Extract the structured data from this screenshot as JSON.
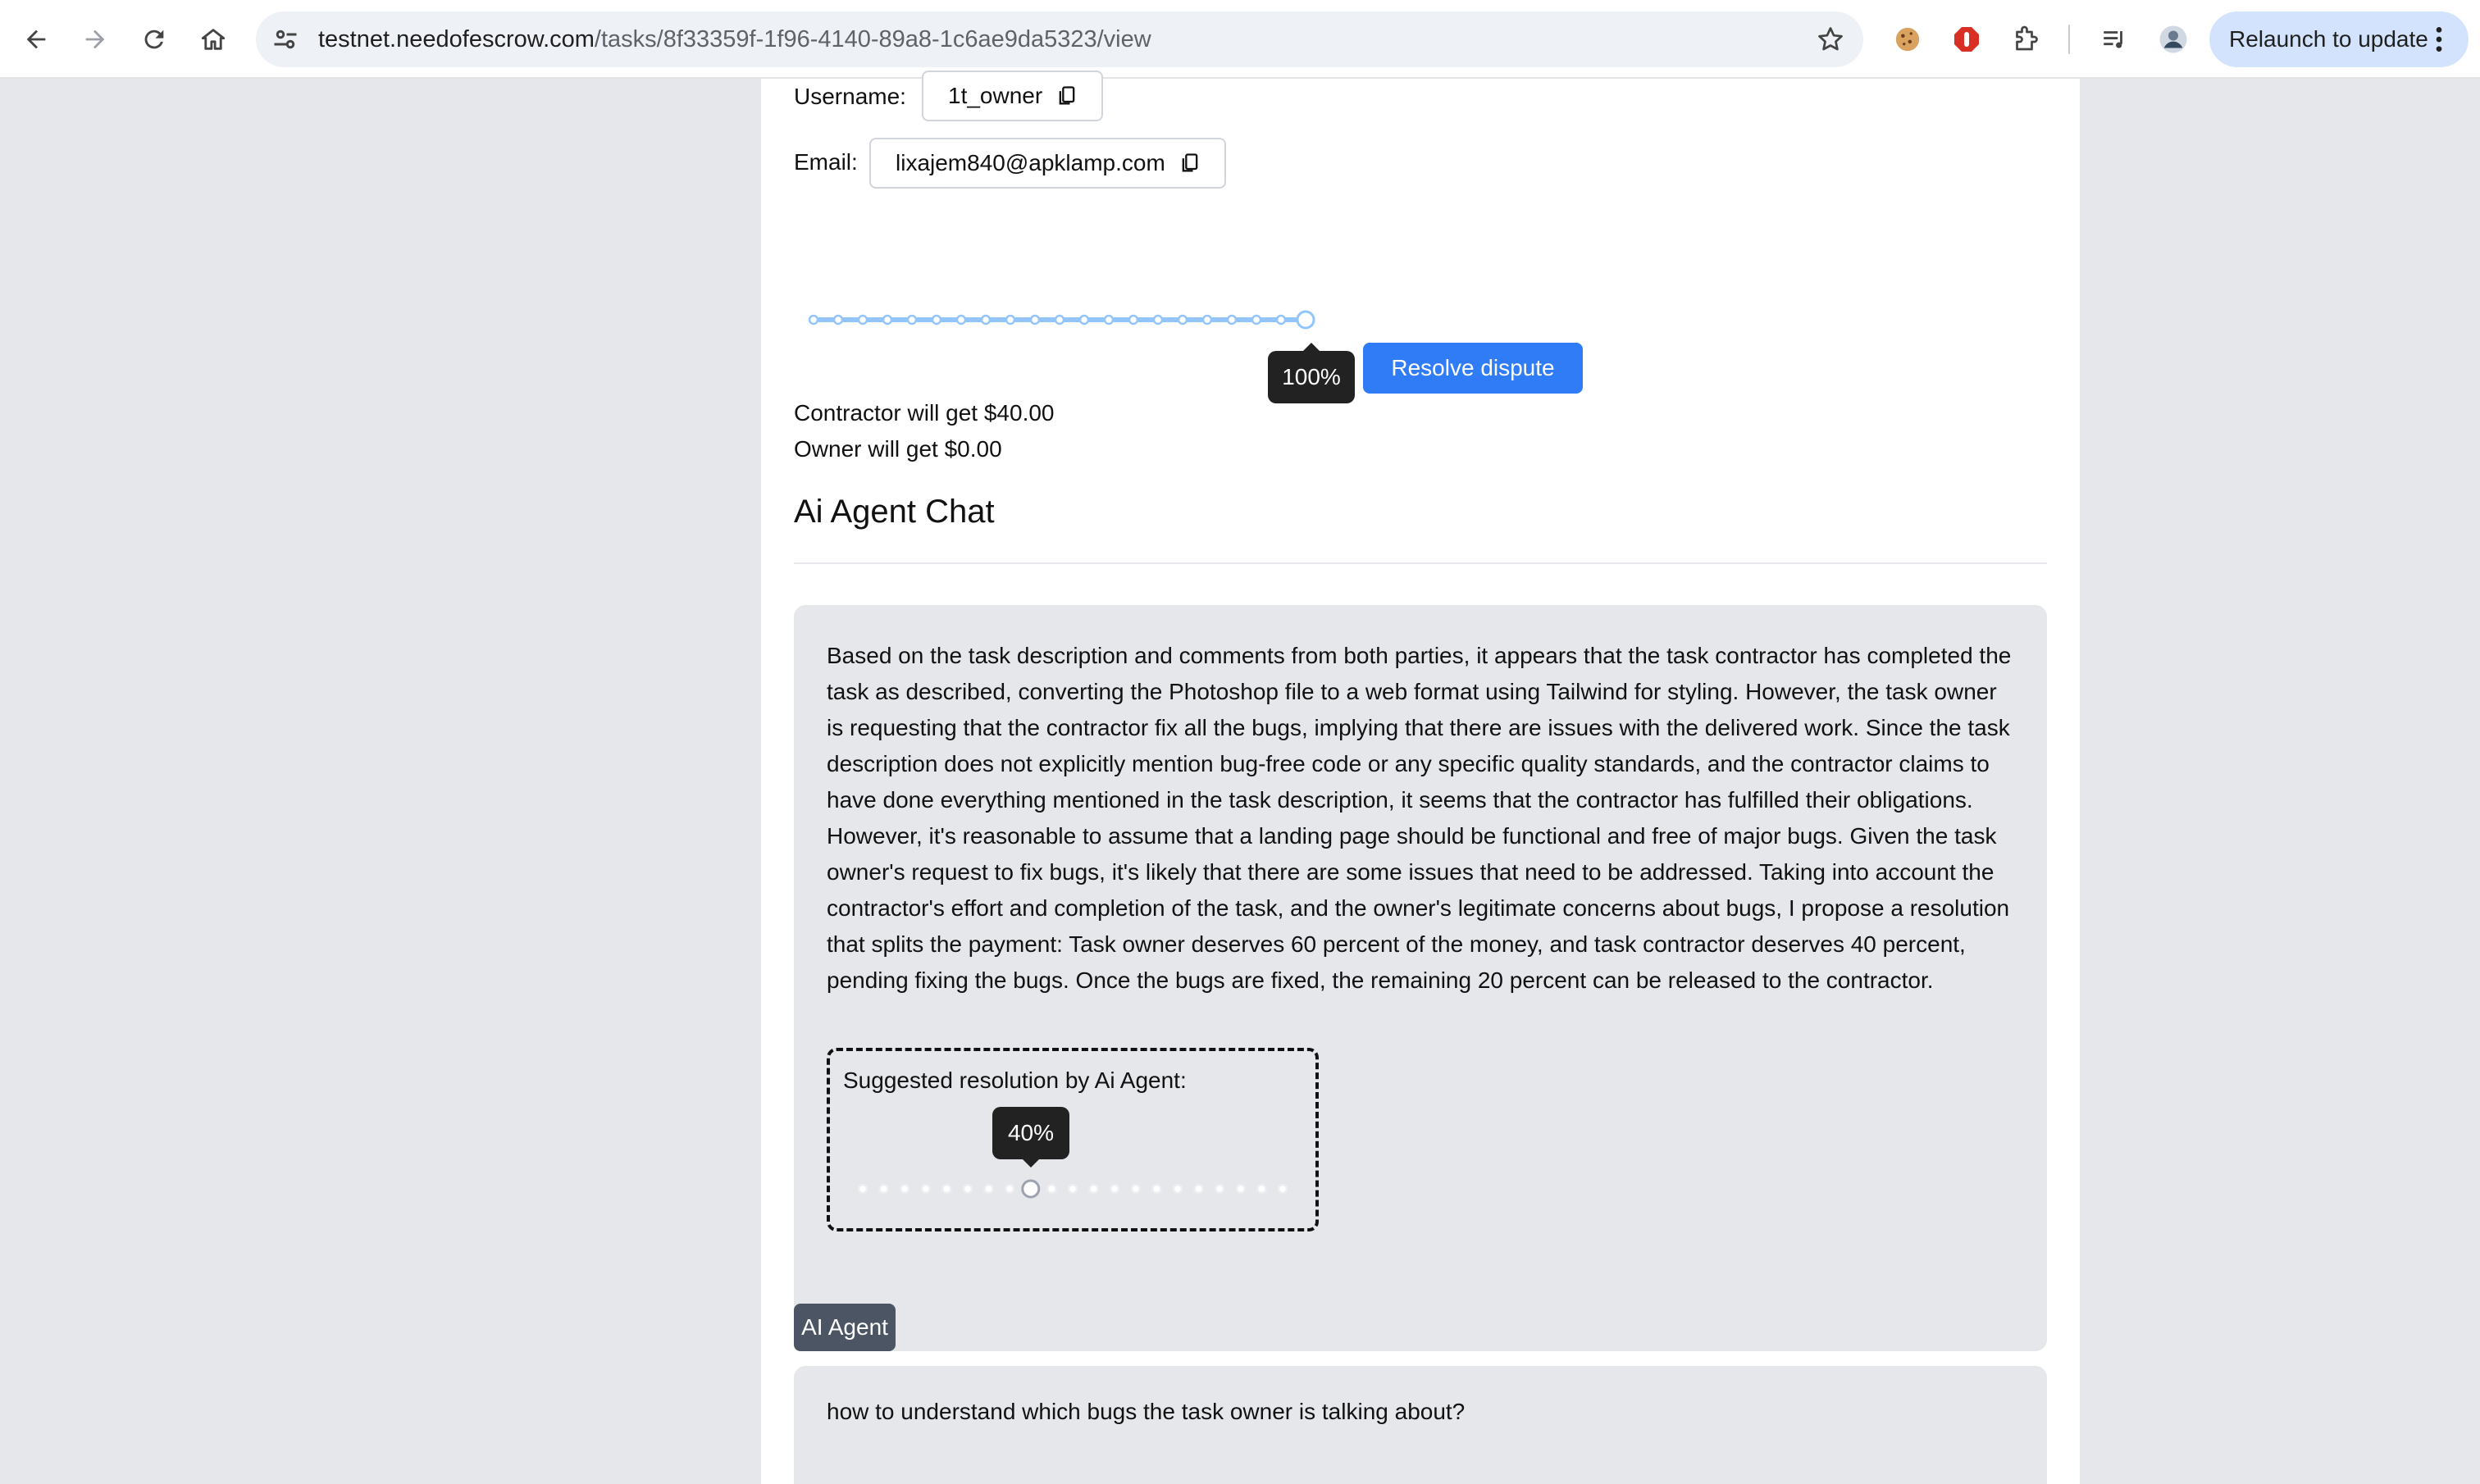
{
  "browser": {
    "url_host": "testnet.needofescrow.com",
    "url_path": "/tasks/8f33359f-1f96-4140-89a8-1c6ae9da5323/view",
    "relaunch_label": "Relaunch to update"
  },
  "user": {
    "username_label": "Username:",
    "username_value": "1t_owner",
    "email_label": "Email:",
    "email_value": "lixajem840@apklamp.com"
  },
  "dispute": {
    "slider_value_label": "100%",
    "slider_percent": 100,
    "slider_steps": 20,
    "resolve_button": "Resolve dispute",
    "contractor_text": "Contractor will get $40.00",
    "owner_text": "Owner will get $0.00"
  },
  "chat": {
    "title": "Ai Agent Chat",
    "agent_message": "Based on the task description and comments from both parties, it appears that the task contractor has completed the task as described, converting the Photoshop file to a web format using Tailwind for styling. However, the task owner is requesting that the contractor fix all the bugs, implying that there are issues with the delivered work. Since the task description does not explicitly mention bug-free code or any specific quality standards, and the contractor claims to have done everything mentioned in the task description, it seems that the contractor has fulfilled their obligations. However, it's reasonable to assume that a landing page should be functional and free of major bugs. Given the task owner's request to fix bugs, it's likely that there are some issues that need to be addressed. Taking into account the contractor's effort and completion of the task, and the owner's legitimate concerns about bugs, I propose a resolution that splits the payment: Task owner deserves 60 percent of the money, and task contractor deserves 40 percent, pending fixing the bugs. Once the bugs are fixed, the remaining 20 percent can be released to the contractor.",
    "suggested_label": "Suggested resolution by Ai Agent:",
    "suggested_value_label": "40%",
    "suggested_percent": 40,
    "sender_badge": "AI Agent",
    "user_message": "how to understand which bugs the task owner is talking about?"
  },
  "colors": {
    "accent": "#2f7cf6",
    "slider_track": "#93c5fd",
    "page_bg": "#e5e7eb"
  }
}
